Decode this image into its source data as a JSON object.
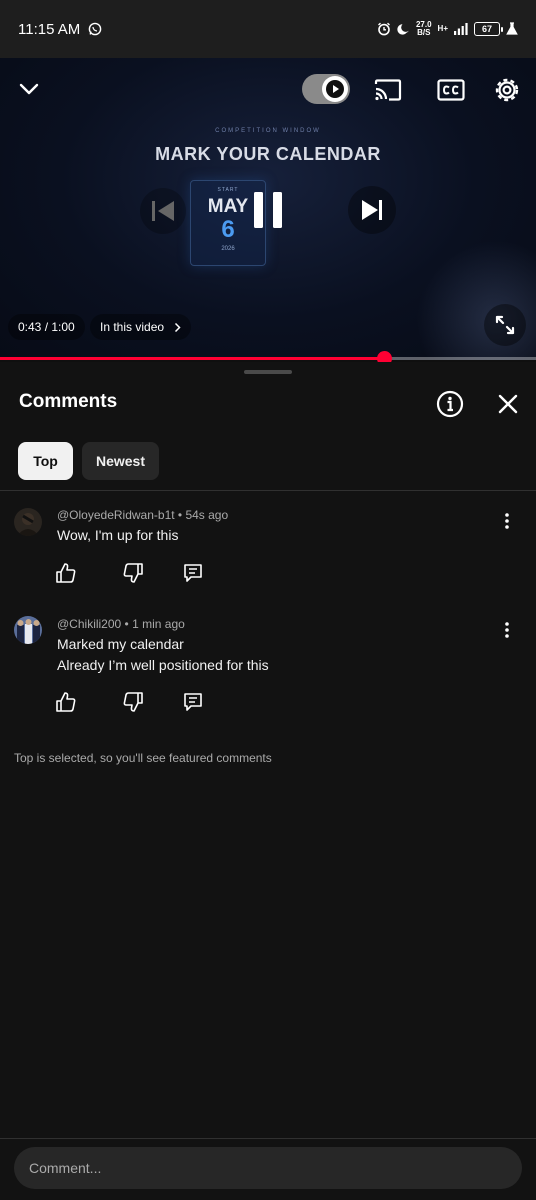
{
  "status_bar": {
    "time": "11:15 AM",
    "net_speed_value": "27.0",
    "net_speed_unit": "B/S",
    "network_type": "H+",
    "battery": "67"
  },
  "player": {
    "video_kicker": "COMPETITION WINDOW",
    "video_heading": "MARK YOUR CALENDAR",
    "calendar": {
      "start_label": "START",
      "month": "MAY",
      "day": "6",
      "year": "2026"
    },
    "time_display": "0:43 / 1:00",
    "chapter_label": "In this video",
    "progress_fraction": 0.716,
    "autoplay_on": true
  },
  "comments_panel": {
    "title": "Comments",
    "filters": [
      {
        "label": "Top",
        "selected": true
      },
      {
        "label": "Newest",
        "selected": false
      }
    ],
    "comments": [
      {
        "author": "@OloyedeRidwan-b1t",
        "time": "54s ago",
        "text_lines": [
          "Wow, I'm up for this"
        ]
      },
      {
        "author": "@Chikili200",
        "time": "1 min ago",
        "text_lines": [
          "Marked my calendar",
          "Already I’m well positioned for this"
        ]
      }
    ],
    "footer_note": "Top is selected, so you'll see featured comments",
    "input_placeholder": "Comment..."
  },
  "colors": {
    "accent_red": "#ff0033",
    "background": "#0f0f0f",
    "chip_selected": "#f1f1f1",
    "chip_unselected": "#272727"
  }
}
